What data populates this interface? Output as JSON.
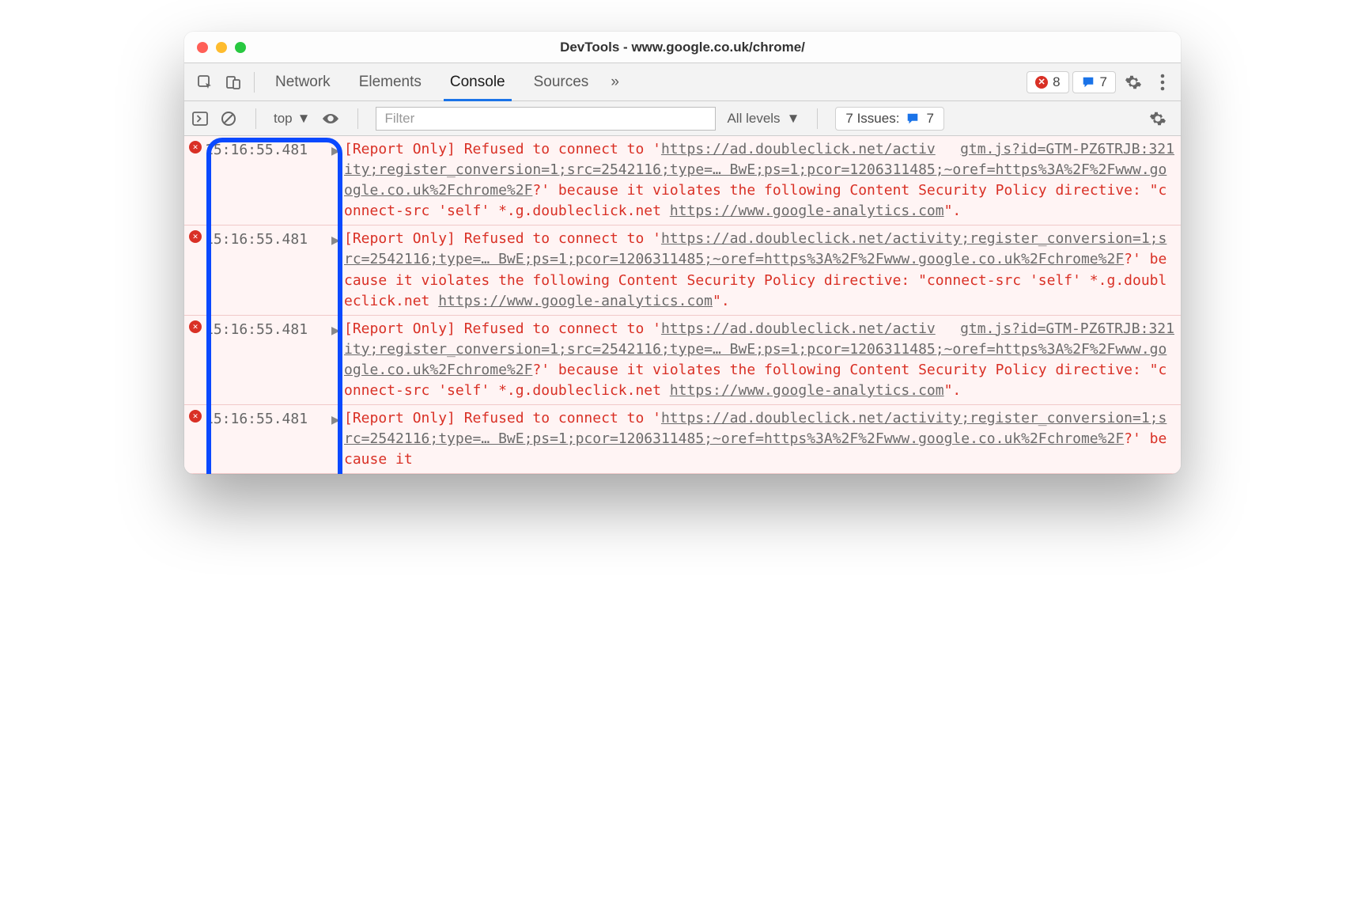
{
  "window": {
    "title": "DevTools - www.google.co.uk/chrome/"
  },
  "tabs": {
    "items": [
      "Network",
      "Elements",
      "Console",
      "Sources"
    ],
    "more": "»",
    "error_count": "8",
    "message_count": "7"
  },
  "toolbar": {
    "context": "top",
    "filter_placeholder": "Filter",
    "levels": "All levels",
    "issues_label": "7 Issues:",
    "issues_count": "7"
  },
  "messages": [
    {
      "timestamp": "15:16:55.481",
      "source": "gtm.js?id=GTM-PZ6TRJB:321",
      "parts": [
        {
          "t": "[Report Only] Refused to connect to '"
        },
        {
          "u": "https://ad.doubleclick.net/activity;register_conversion=1;src=2542116;type=… BwE;ps=1;pcor=1206311485;~oref=https%3A%2F%2Fwww.google.co.uk%2Fchrome%2F"
        },
        {
          "t": "?' because it violates the following Content Security Policy directive: \"connect-src 'self' *.g.doubleclick.net "
        },
        {
          "u": "https://www.google-analytics.com"
        },
        {
          "t": "\"."
        }
      ]
    },
    {
      "timestamp": "15:16:55.481",
      "source": "",
      "parts": [
        {
          "t": "[Report Only] Refused to connect to '"
        },
        {
          "u": "https://ad.doubleclick.net/activity;register_conversion=1;src=2542116;type=… BwE;ps=1;pcor=1206311485;~oref=https%3A%2F%2Fwww.google.co.uk%2Fchrome%2F"
        },
        {
          "t": "?' because it violates the following Content Security Policy directive: \"connect-src 'self' *.g.doubleclick.net "
        },
        {
          "u": "https://www.google-analytics.com"
        },
        {
          "t": "\"."
        }
      ]
    },
    {
      "timestamp": "15:16:55.481",
      "source": "gtm.js?id=GTM-PZ6TRJB:321",
      "parts": [
        {
          "t": "[Report Only] Refused to connect to '"
        },
        {
          "u": "https://ad.doubleclick.net/activity;register_conversion=1;src=2542116;type=… BwE;ps=1;pcor=1206311485;~oref=https%3A%2F%2Fwww.google.co.uk%2Fchrome%2F"
        },
        {
          "t": "?' because it violates the following Content Security Policy directive: \"connect-src 'self' *.g.doubleclick.net "
        },
        {
          "u": "https://www.google-analytics.com"
        },
        {
          "t": "\"."
        }
      ]
    },
    {
      "timestamp": "15:16:55.481",
      "source": "",
      "parts": [
        {
          "t": "[Report Only] Refused to connect to '"
        },
        {
          "u": "https://ad.doubleclick.net/activity;register_conversion=1;src=2542116;type=… BwE;ps=1;pcor=1206311485;~oref=https%3A%2F%2Fwww.google.co.uk%2Fchrome%2F"
        },
        {
          "t": "?' because it "
        }
      ]
    }
  ],
  "annotation": {
    "purpose": "highlight-timestamps"
  }
}
